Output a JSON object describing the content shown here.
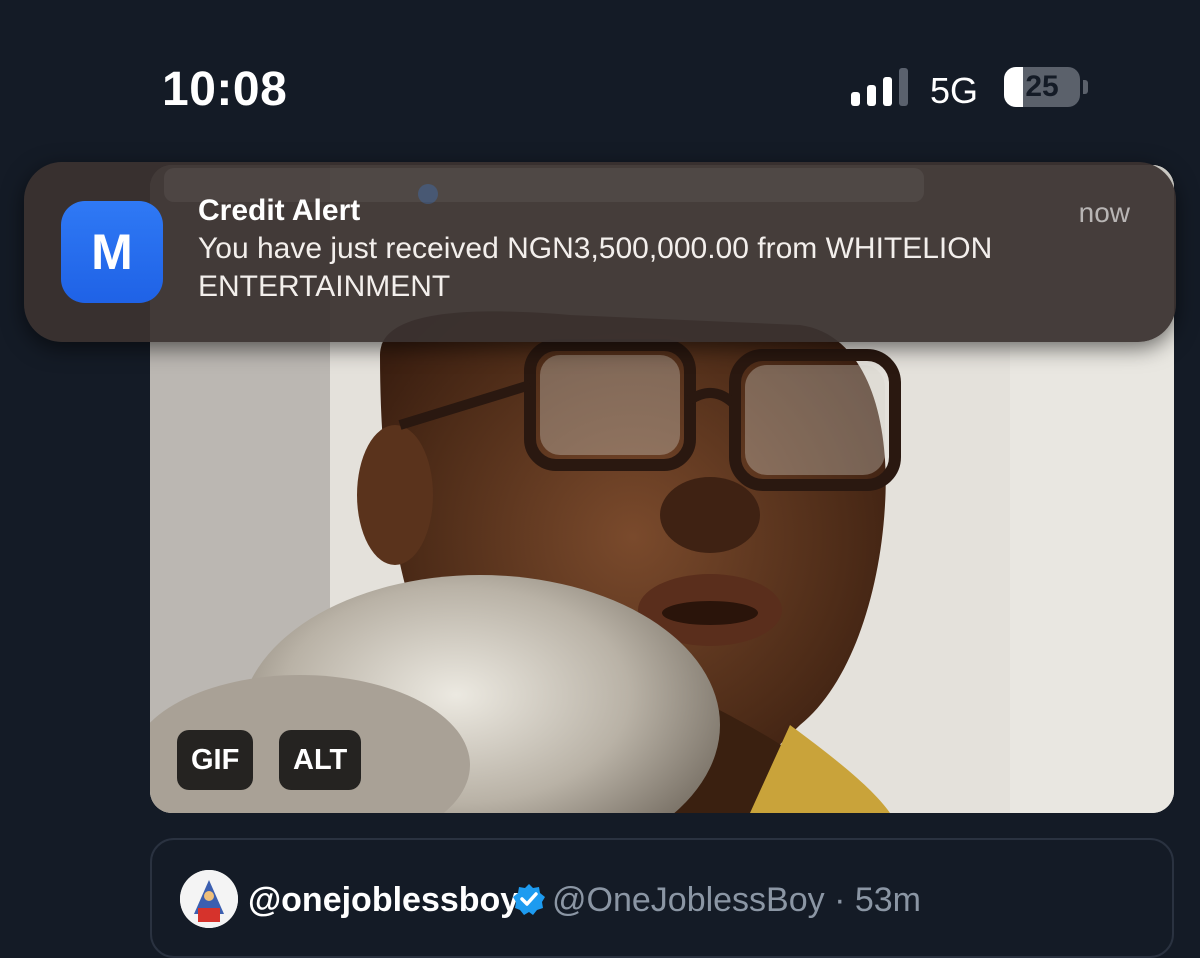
{
  "status_bar": {
    "time": "10:08",
    "network": "5G",
    "signal_bars": 3,
    "signal_bars_total": 4,
    "battery_level": "25",
    "battery_fraction": 0.25
  },
  "notification": {
    "app_icon_letter": "M",
    "title": "Credit Alert",
    "time": "now",
    "body": "You have just received NGN3,500,000.00 from WHITELION ENTERTAINMENT"
  },
  "media": {
    "badges": [
      "GIF",
      "ALT"
    ]
  },
  "quoted_tweet": {
    "display_name": "@onejoblessboy",
    "handle_time": "@OneJoblessBoy · 53m"
  },
  "colors": {
    "background": "#141b26",
    "notification_bg": "#3a3230",
    "app_icon": "#2f79f5",
    "verified": "#1d9bf0",
    "muted_text": "#8b96a4"
  },
  "icons": {
    "signal": "cellular-signal-icon",
    "battery": "battery-icon",
    "app": "bank-app-icon",
    "verified": "verified-badge-icon"
  }
}
